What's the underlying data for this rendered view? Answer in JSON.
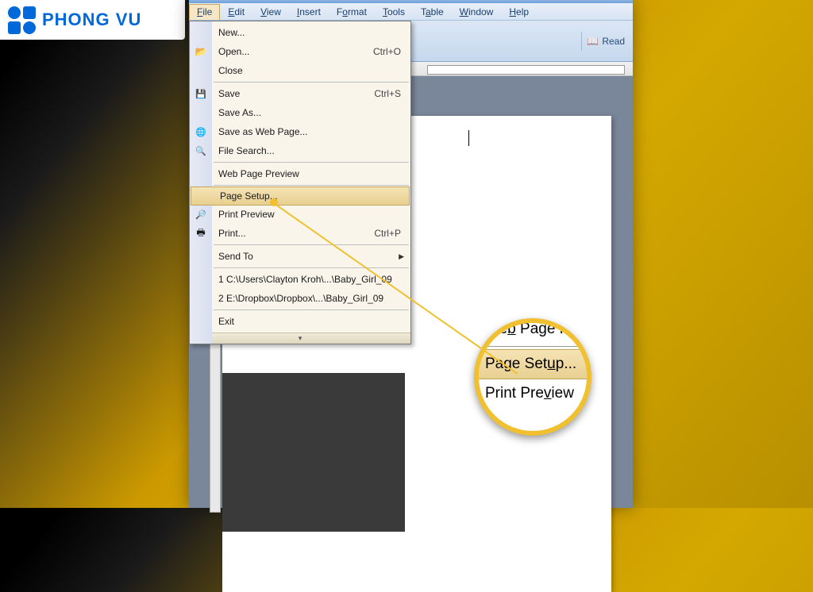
{
  "logo": {
    "text": "PHONG VU"
  },
  "menubar": {
    "file": "File",
    "edit": "Edit",
    "view": "View",
    "insert": "Insert",
    "format": "Format",
    "tools": "Tools",
    "table": "Table",
    "window": "Window",
    "help": "Help"
  },
  "toolbar": {
    "read": "Read"
  },
  "file_menu": {
    "new": "New...",
    "open": "Open...",
    "open_shortcut": "Ctrl+O",
    "close": "Close",
    "save": "Save",
    "save_shortcut": "Ctrl+S",
    "save_as": "Save As...",
    "save_web": "Save as Web Page...",
    "file_search": "File Search...",
    "web_preview": "Web Page Preview",
    "page_setup": "Page Setup...",
    "print_preview": "Print Preview",
    "print": "Print...",
    "print_shortcut": "Ctrl+P",
    "send_to": "Send To",
    "recent1": "1 C:\\Users\\Clayton Kroh\\...\\Baby_Girl_09",
    "recent2": "2 E:\\Dropbox\\Dropbox\\...\\Baby_Girl_09",
    "exit": "Exit"
  },
  "magnifier": {
    "web_preview": "Web Page Preview",
    "page_setup": "Page Setup...",
    "print_preview": "Print Preview"
  }
}
